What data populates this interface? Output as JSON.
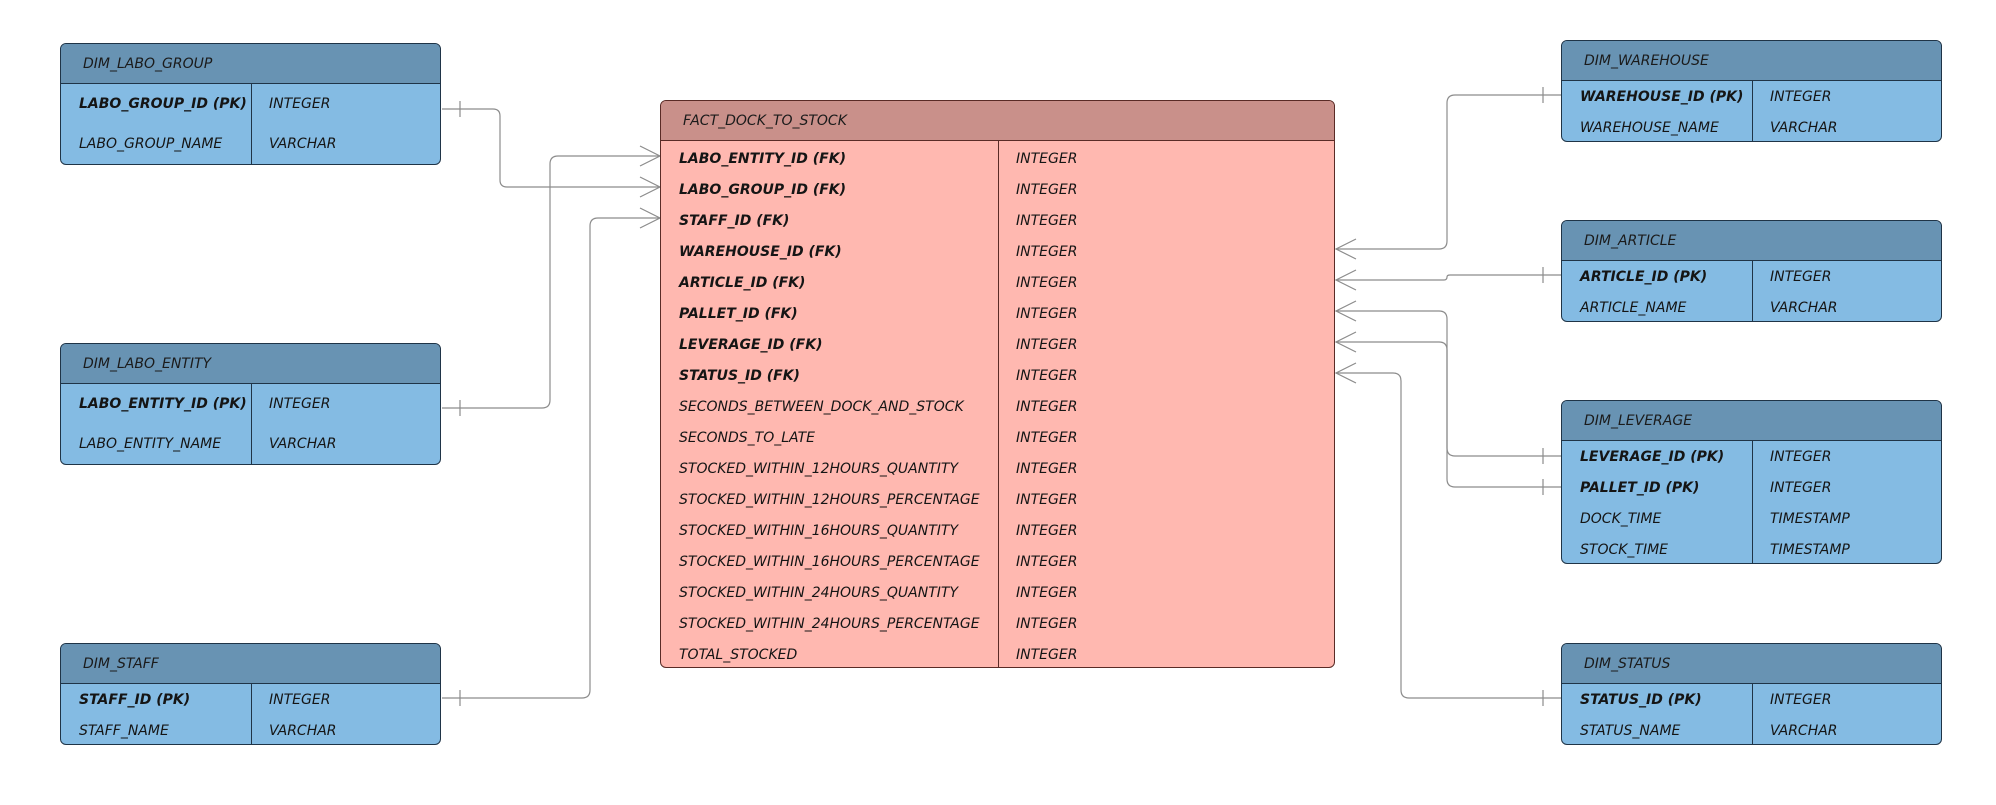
{
  "fact": {
    "title": "FACT_DOCK_TO_STOCK",
    "rows": [
      {
        "name": "LABO_ENTITY_ID (FK)",
        "type": "INTEGER",
        "key": true
      },
      {
        "name": "LABO_GROUP_ID (FK)",
        "type": "INTEGER",
        "key": true
      },
      {
        "name": "STAFF_ID (FK)",
        "type": "INTEGER",
        "key": true
      },
      {
        "name": "WAREHOUSE_ID (FK)",
        "type": "INTEGER",
        "key": true
      },
      {
        "name": "ARTICLE_ID (FK)",
        "type": "INTEGER",
        "key": true
      },
      {
        "name": "PALLET_ID (FK)",
        "type": "INTEGER",
        "key": true
      },
      {
        "name": "LEVERAGE_ID (FK)",
        "type": "INTEGER",
        "key": true
      },
      {
        "name": "STATUS_ID (FK)",
        "type": "INTEGER",
        "key": true
      },
      {
        "name": "SECONDS_BETWEEN_DOCK_AND_STOCK",
        "type": "INTEGER",
        "key": false
      },
      {
        "name": "SECONDS_TO_LATE",
        "type": "INTEGER",
        "key": false
      },
      {
        "name": "STOCKED_WITHIN_12HOURS_QUANTITY",
        "type": "INTEGER",
        "key": false
      },
      {
        "name": "STOCKED_WITHIN_12HOURS_PERCENTAGE",
        "type": "INTEGER",
        "key": false
      },
      {
        "name": "STOCKED_WITHIN_16HOURS_QUANTITY",
        "type": "INTEGER",
        "key": false
      },
      {
        "name": "STOCKED_WITHIN_16HOURS_PERCENTAGE",
        "type": "INTEGER",
        "key": false
      },
      {
        "name": "STOCKED_WITHIN_24HOURS_QUANTITY",
        "type": "INTEGER",
        "key": false
      },
      {
        "name": "STOCKED_WITHIN_24HOURS_PERCENTAGE",
        "type": "INTEGER",
        "key": false
      },
      {
        "name": "TOTAL_STOCKED",
        "type": "INTEGER",
        "key": false
      }
    ]
  },
  "dims": {
    "labo_group": {
      "title": "DIM_LABO_GROUP",
      "rows": [
        {
          "name": "LABO_GROUP_ID (PK)",
          "type": "INTEGER",
          "key": true
        },
        {
          "name": "LABO_GROUP_NAME",
          "type": "VARCHAR",
          "key": false
        }
      ]
    },
    "labo_entity": {
      "title": "DIM_LABO_ENTITY",
      "rows": [
        {
          "name": "LABO_ENTITY_ID (PK)",
          "type": "INTEGER",
          "key": true
        },
        {
          "name": "LABO_ENTITY_NAME",
          "type": "VARCHAR",
          "key": false
        }
      ]
    },
    "staff": {
      "title": "DIM_STAFF",
      "rows": [
        {
          "name": "STAFF_ID (PK)",
          "type": "INTEGER",
          "key": true
        },
        {
          "name": "STAFF_NAME",
          "type": "VARCHAR",
          "key": false
        }
      ]
    },
    "warehouse": {
      "title": "DIM_WAREHOUSE",
      "rows": [
        {
          "name": "WAREHOUSE_ID (PK)",
          "type": "INTEGER",
          "key": true
        },
        {
          "name": "WAREHOUSE_NAME",
          "type": "VARCHAR",
          "key": false
        }
      ]
    },
    "article": {
      "title": "DIM_ARTICLE",
      "rows": [
        {
          "name": "ARTICLE_ID (PK)",
          "type": "INTEGER",
          "key": true
        },
        {
          "name": "ARTICLE_NAME",
          "type": "VARCHAR",
          "key": false
        }
      ]
    },
    "leverage": {
      "title": "DIM_LEVERAGE",
      "rows": [
        {
          "name": "LEVERAGE_ID (PK)",
          "type": "INTEGER",
          "key": true
        },
        {
          "name": "PALLET_ID (PK)",
          "type": "INTEGER",
          "key": true
        },
        {
          "name": "DOCK_TIME",
          "type": "TIMESTAMP",
          "key": false
        },
        {
          "name": "STOCK_TIME",
          "type": "TIMESTAMP",
          "key": false
        }
      ]
    },
    "status": {
      "title": "DIM_STATUS",
      "rows": [
        {
          "name": "STATUS_ID (PK)",
          "type": "INTEGER",
          "key": true
        },
        {
          "name": "STATUS_NAME",
          "type": "VARCHAR",
          "key": false
        }
      ]
    }
  },
  "colors": {
    "fact_header": "#c9908a",
    "fact_body": "#ffb8b0",
    "dim_header": "#6893b3",
    "dim_body": "#84bbe3",
    "connector": "#8c8c8c"
  }
}
